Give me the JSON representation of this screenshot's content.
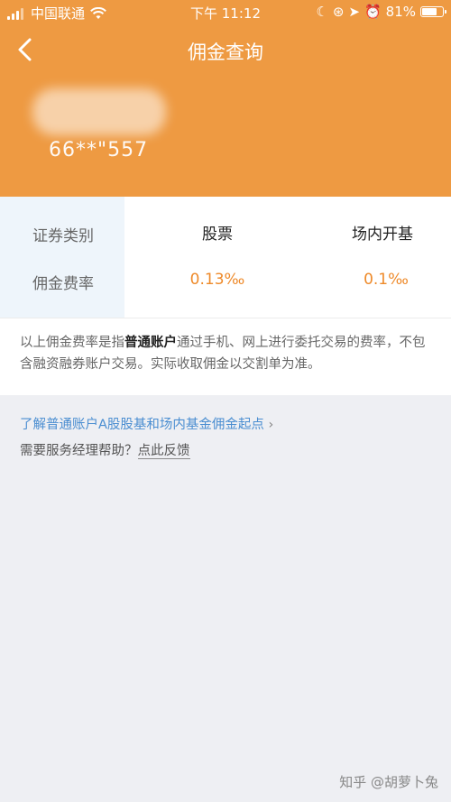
{
  "status_bar": {
    "carrier": "中国联通",
    "time": "下午 11:12",
    "battery": "81%",
    "battery_level": 0.81
  },
  "nav": {
    "title": "佣金查询"
  },
  "account": {
    "masked_number": "66**\"557"
  },
  "fee_table": {
    "row_labels": [
      "证券类别",
      "佣金费率"
    ],
    "columns": [
      {
        "header": "股票",
        "rate": "0.13‰"
      },
      {
        "header": "场内开基",
        "rate": "0.1‰"
      }
    ]
  },
  "note": {
    "prefix": "以上佣金费率是指",
    "highlight": "普通账户",
    "suffix": "通过手机、网上进行委托交易的费率，不包含融资融券账户交易。实际收取佣金以交割单为准。"
  },
  "links": {
    "learn_more": "了解普通账户A股股基和场内基金佣金起点",
    "help_prompt": "需要服务经理帮助？",
    "feedback": "点此反馈"
  },
  "watermark": "知乎 @胡萝卜兔",
  "colors": {
    "header_bg": "#ee9a42",
    "rate_text": "#ee8a2a",
    "link": "#4b8ed1",
    "page_bg": "#eeeff3"
  }
}
